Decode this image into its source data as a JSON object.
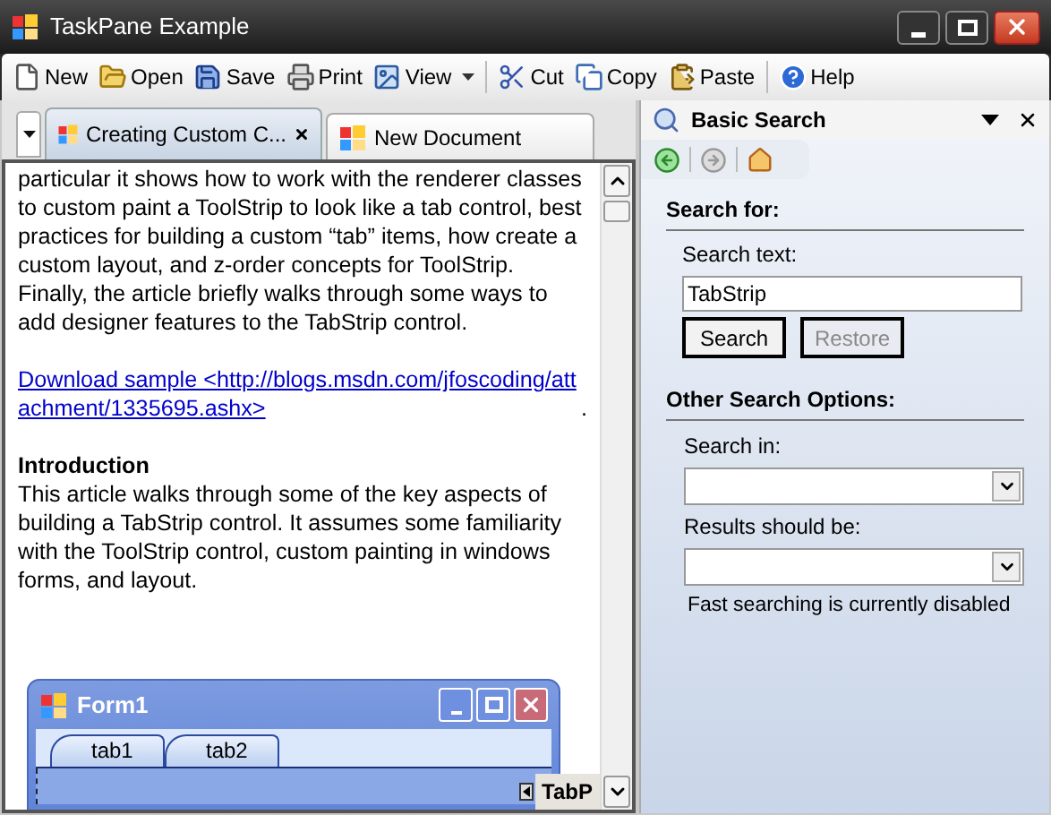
{
  "window": {
    "title": "TaskPane Example"
  },
  "toolbar": [
    {
      "items": [
        {
          "label": "New",
          "dropdown": false
        },
        {
          "label": "Open",
          "dropdown": false
        },
        {
          "label": "Save",
          "dropdown": false
        },
        {
          "label": "Print",
          "dropdown": false
        },
        {
          "label": "View",
          "dropdown": true
        }
      ]
    },
    {
      "items": [
        {
          "label": "Cut",
          "dropdown": false
        },
        {
          "label": "Copy",
          "dropdown": false
        },
        {
          "label": "Paste",
          "dropdown": false
        }
      ]
    },
    {
      "items": [
        {
          "label": "Help",
          "dropdown": false
        }
      ]
    }
  ],
  "document_tabs": [
    {
      "label": "Creating Custom C...",
      "selected": true
    },
    {
      "label": "New Document",
      "selected": false
    }
  ],
  "article": [
    {
      "kind": "text",
      "text": "particular it shows how to work with the renderer classes to custom paint a ToolStrip to look like a tab control, best practices for building a custom “tab” items, how create a custom layout, and z-order concepts for ToolStrip.  Finally, the article briefly walks through some ways to add designer features to the TabStrip control."
    },
    {
      "kind": "link",
      "text": "Download sample <http://blogs.msdn.com/jfoscoding/attachment/1335695.ashx>",
      "after": "."
    },
    {
      "kind": "heading",
      "text": "Introduction"
    },
    {
      "kind": "text",
      "text": "This article walks through some of the key aspects of building a TabStrip control.  It assumes some familiarity with the ToolStrip control, custom painting in windows forms, and layout."
    }
  ],
  "figure": {
    "window_title": "Form1",
    "tabs": [
      {
        "label": "tab1"
      },
      {
        "label": "tab2"
      }
    ],
    "cut_label": "TabP"
  },
  "task_pane": {
    "title": "Basic Search",
    "nav": [
      {
        "disabled": false
      },
      {
        "disabled": true
      },
      {
        "disabled": false
      }
    ],
    "sections": [
      {
        "heading": "Search for:",
        "field_label": "Search text:",
        "field_value": "TabStrip",
        "buttons": [
          {
            "label": "Search",
            "disabled": false
          },
          {
            "label": "Restore",
            "disabled": true
          }
        ]
      },
      {
        "heading": "Other Search Options:",
        "selects": [
          {
            "label": "Search in:"
          },
          {
            "label": "Results should be:"
          }
        ],
        "note": "Fast searching is currently disabled"
      }
    ]
  }
}
